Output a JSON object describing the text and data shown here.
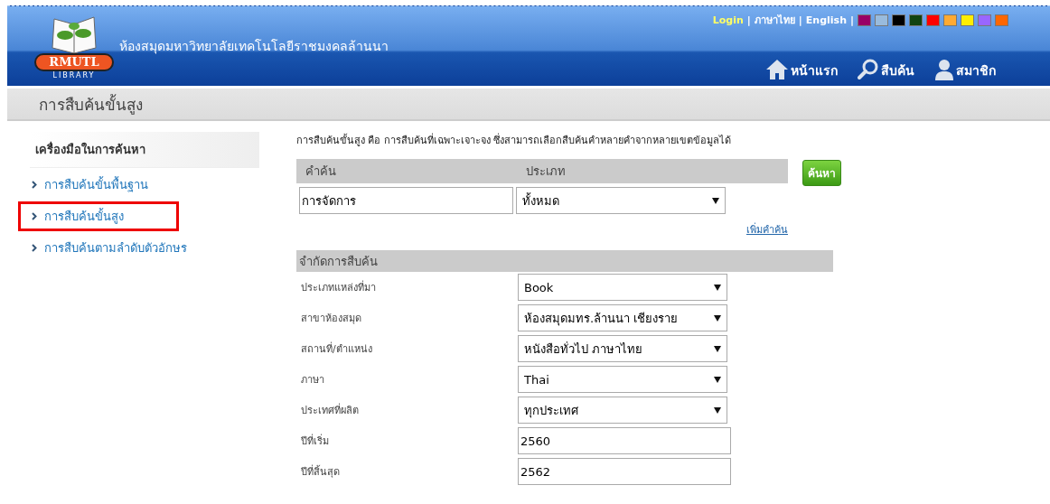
{
  "header": {
    "logo_text": "RMUTL",
    "logo_sub": "LIBRARY",
    "title": "ห้องสมุดมหาวิทยาลัยเทคโนโลยีราชมงคลล้านนา",
    "top_links": [
      {
        "label": "Login",
        "kind": "login",
        "separator": "|"
      },
      {
        "label": "ภาษาไทย",
        "kind": "link",
        "separator": "|"
      },
      {
        "label": "English",
        "kind": "link",
        "separator": "|"
      }
    ],
    "themes": [
      {
        "color": "#990066"
      },
      {
        "color": "#99bbdd"
      },
      {
        "color": "#000000"
      },
      {
        "color": "#114411"
      },
      {
        "color": "#ff0000"
      },
      {
        "color": "#ffaa33"
      },
      {
        "color": "#ffee00"
      },
      {
        "color": "#9966ff"
      },
      {
        "color": "#ff6600"
      }
    ],
    "nav": [
      {
        "label": "หน้าแรก",
        "kind": "home"
      },
      {
        "label": "สืบค้น",
        "kind": "search"
      },
      {
        "label": "สมาชิก",
        "kind": "member"
      }
    ]
  },
  "page_title": "การสืบค้นขั้นสูง",
  "sidebar": {
    "title": "เครื่องมือในการค้นหา",
    "items": [
      {
        "label": "การสืบค้นขั้นพื้นฐาน",
        "selected": false
      },
      {
        "label": "การสืบค้นขั้นสูง",
        "selected": true
      },
      {
        "label": "การสืบค้นตามลำดับตัวอักษร",
        "selected": false
      }
    ]
  },
  "intro": "การสืบค้นขั้นสูง คือ การสืบค้นที่เฉพาะเจาะจง ซึ่งสามารถเลือกสืบค้นคำหลายคำจากหลายเขตข้อมูลได้",
  "query": {
    "columns": [
      "คำค้น",
      "ประเภท"
    ],
    "term": "การจัดการ",
    "type": "ทั้งหมด",
    "add_link": "เพิ่มคำค้น",
    "search_button": "ค้นหา"
  },
  "limits": {
    "title": "จำกัดการสืบค้น",
    "rows": [
      {
        "label": "ประเภทแหล่งที่มา",
        "kind": "select",
        "value": "Book"
      },
      {
        "label": "สาขาห้องสมุด",
        "kind": "select",
        "value": "ห้องสมุดมทร.ล้านนา เชียงราย"
      },
      {
        "label": "สถานที่/ตำแหน่ง",
        "kind": "select",
        "value": "หนังสือทั่วไป ภาษาไทย"
      },
      {
        "label": "ภาษา",
        "kind": "select",
        "value": "Thai"
      },
      {
        "label": "ประเทศที่ผลิต",
        "kind": "select",
        "value": "ทุกประเทศ"
      },
      {
        "label": "ปีที่เริ่ม",
        "kind": "input",
        "value": "2560"
      },
      {
        "label": "ปีที่สิ้นสุด",
        "kind": "input",
        "value": "2562"
      }
    ]
  }
}
